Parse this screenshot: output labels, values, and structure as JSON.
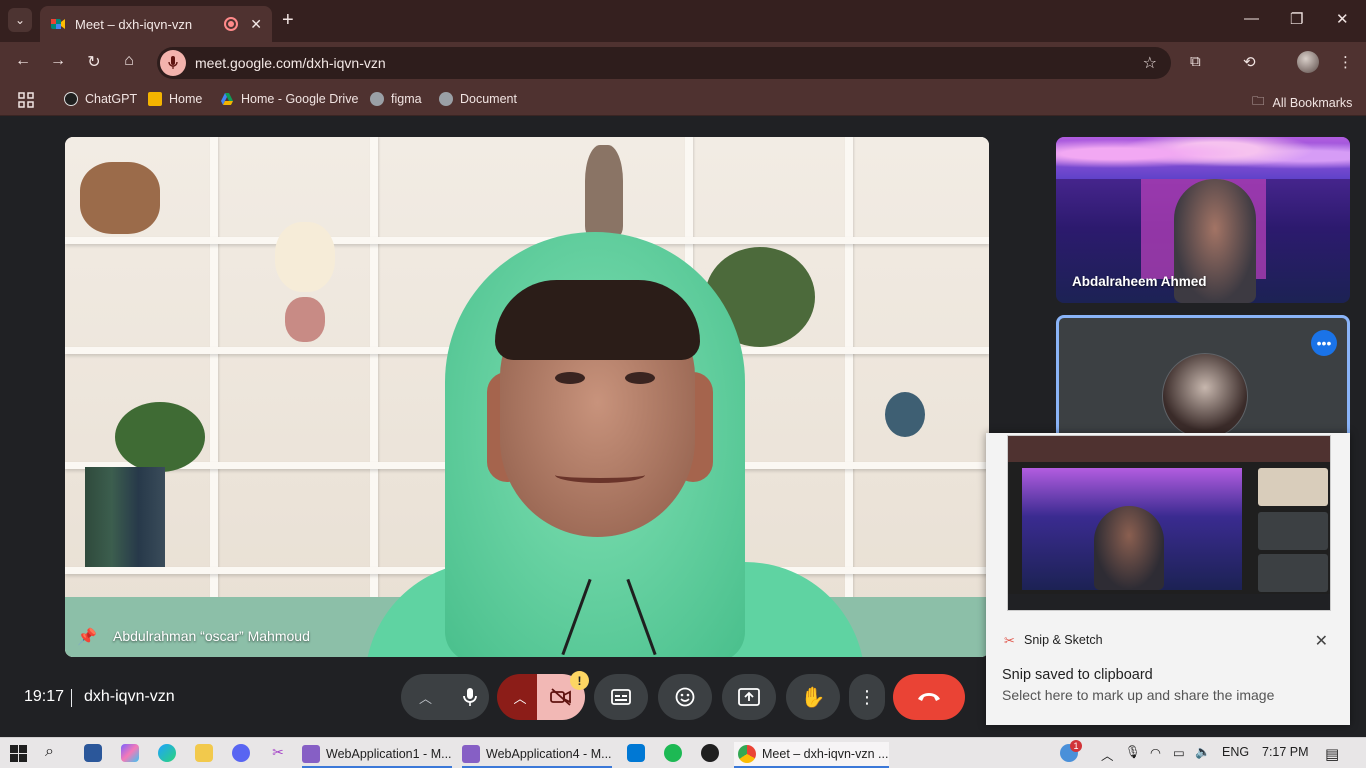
{
  "browser": {
    "tab_title": "Meet – dxh-iqvn-vzn",
    "url": "meet.google.com/dxh-iqvn-vzn",
    "new_tab": "+",
    "close_tab": "✕",
    "window_controls": {
      "minimize": "—",
      "restore": "❐",
      "close": "✕"
    }
  },
  "bookmarks": [
    {
      "label": "ChatGPT",
      "icon": "chatgpt-icon",
      "color": "#1f1f1f"
    },
    {
      "label": "Home",
      "icon": "home-bookmark-icon",
      "color": "#f4b400"
    },
    {
      "label": "Home - Google Drive",
      "icon": "drive-icon",
      "color": "#0f9d58"
    },
    {
      "label": "figma",
      "icon": "globe-icon",
      "color": "#9aa0a6"
    },
    {
      "label": "Document",
      "icon": "globe-icon",
      "color": "#9aa0a6"
    }
  ],
  "all_bookmarks": "All Bookmarks",
  "meet": {
    "main_participant": "Abdulrahman “oscar” Mahmoud",
    "side_participant": "Abdalraheem Ahmed",
    "time": "19:17",
    "meeting_code": "dxh-iqvn-vzn",
    "camera_warning": "!"
  },
  "toast": {
    "app_name": "Snip & Sketch",
    "title": "Snip saved to clipboard",
    "subtitle": "Select here to mark up and share the image"
  },
  "taskbar": {
    "items": [
      {
        "label": "WebApplication1 - M..."
      },
      {
        "label": "WebApplication4 - M..."
      },
      {
        "label": "Meet – dxh-iqvn-vzn ..."
      }
    ],
    "language": "ENG",
    "clock": "7:17 PM",
    "notification_count": "1"
  },
  "colors": {
    "accent": "#8ab4f8",
    "end_call": "#ea4335",
    "camera_off": "#8c1d18",
    "camera_pink": "#f2b8b5"
  }
}
